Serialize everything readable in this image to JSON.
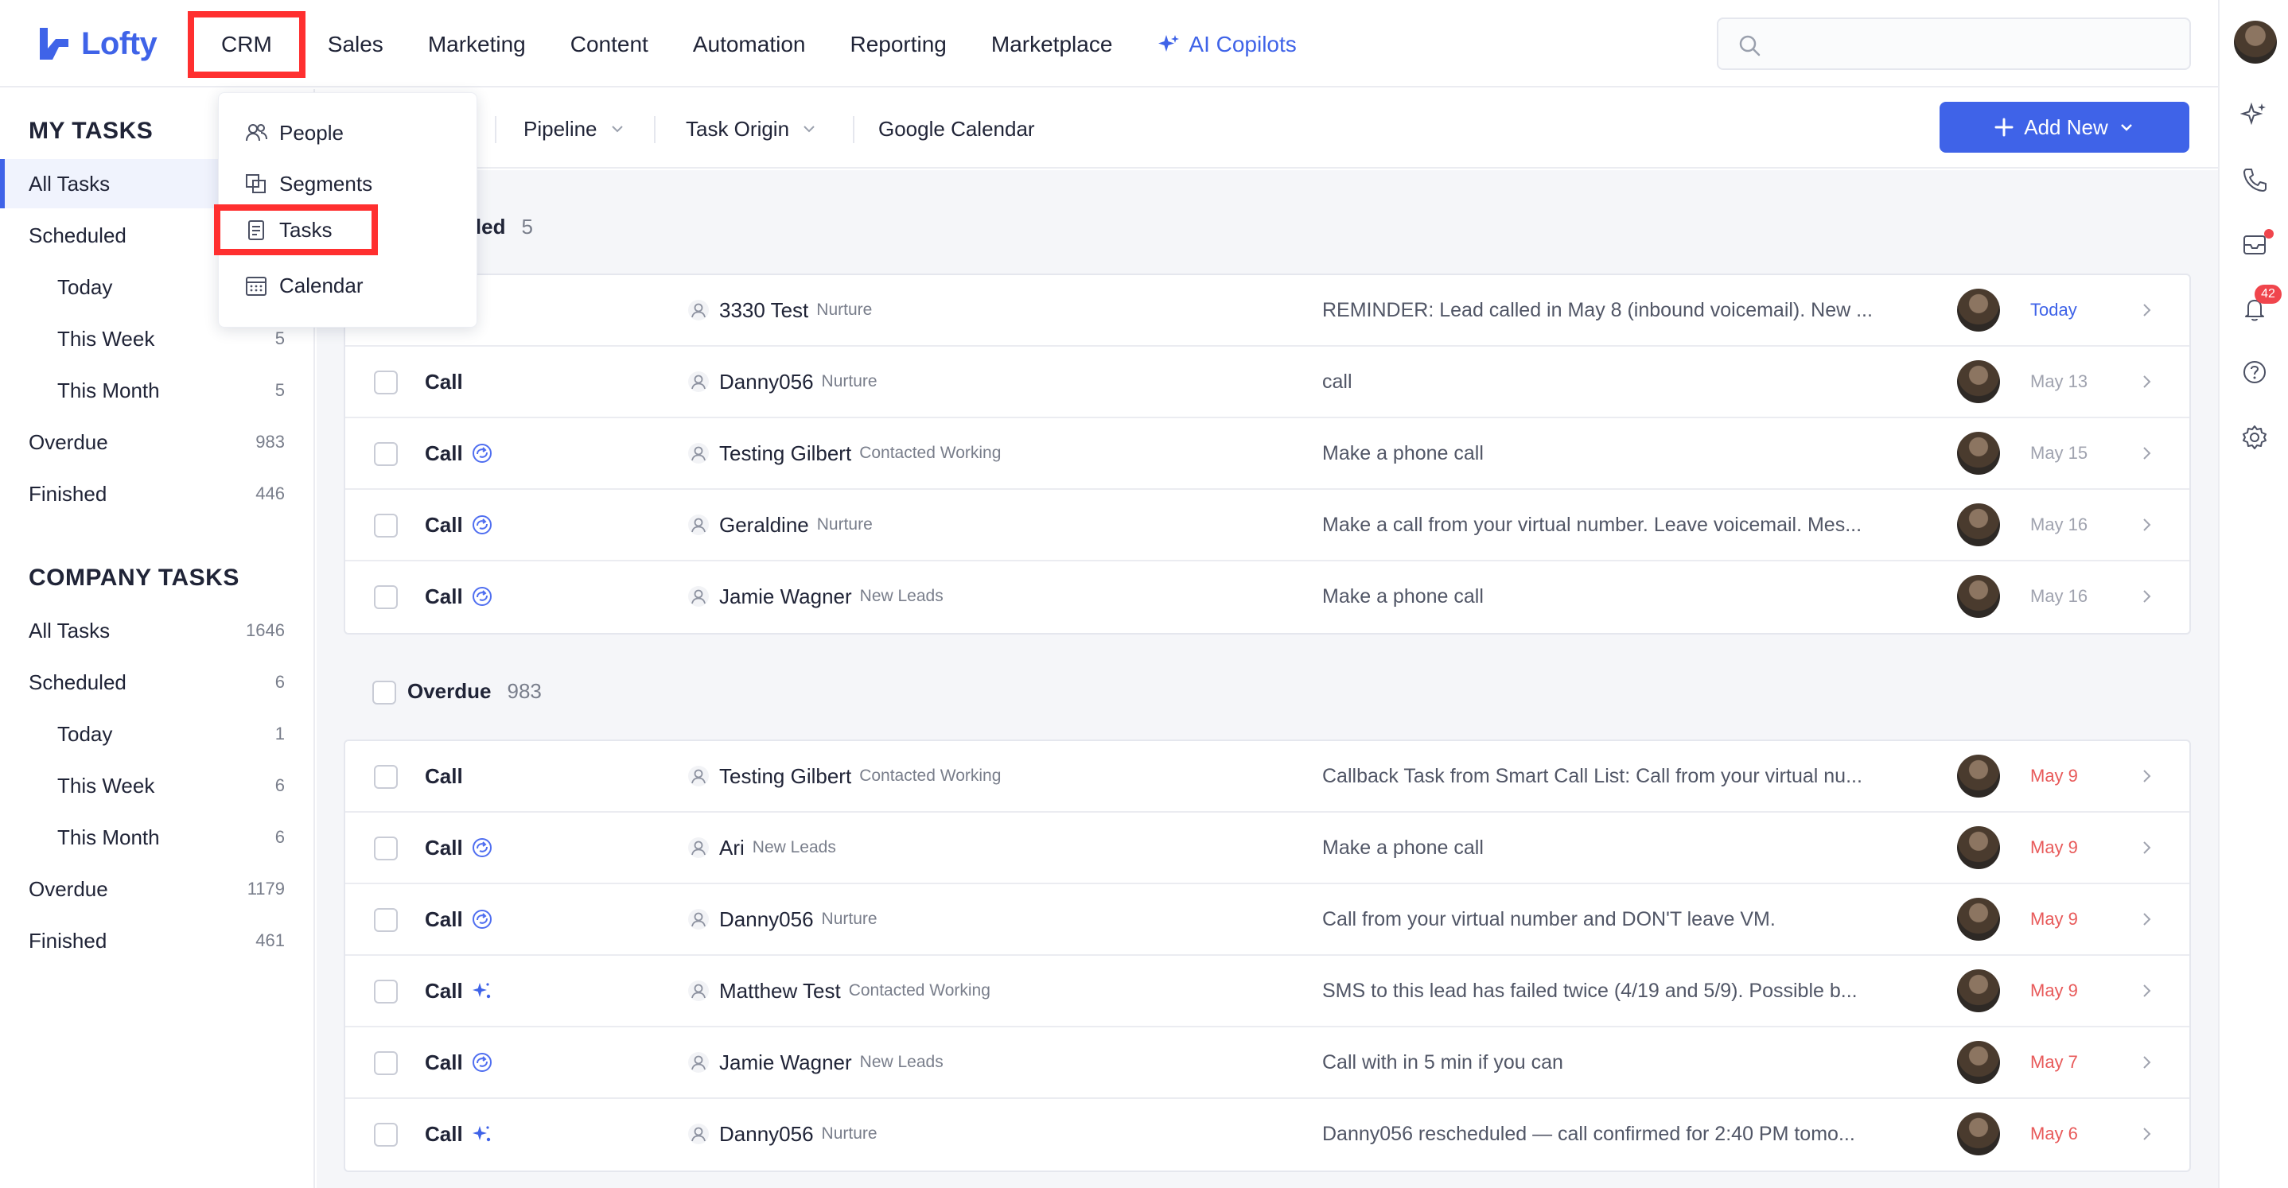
{
  "brand": {
    "name": "Lofty",
    "color": "#3f63e8"
  },
  "nav": {
    "items": [
      "CRM",
      "Sales",
      "Marketing",
      "Content",
      "Automation",
      "Reporting",
      "Marketplace"
    ],
    "ai_label": "AI Copilots"
  },
  "search": {
    "placeholder": ""
  },
  "rail": {
    "notification_count": "42"
  },
  "dropdown": {
    "items": [
      "People",
      "Segments",
      "Tasks",
      "Calendar"
    ]
  },
  "sidebar": {
    "my_tasks_title": "MY TASKS",
    "my_tasks": [
      {
        "label": "All Tasks",
        "count": ""
      },
      {
        "label": "Scheduled",
        "count": ""
      },
      {
        "label": "Today",
        "count": ""
      },
      {
        "label": "This Week",
        "count": "5"
      },
      {
        "label": "This Month",
        "count": "5"
      },
      {
        "label": "Overdue",
        "count": "983"
      },
      {
        "label": "Finished",
        "count": "446"
      }
    ],
    "company_tasks_title": "COMPANY TASKS",
    "company_tasks": [
      {
        "label": "All Tasks",
        "count": "1646"
      },
      {
        "label": "Scheduled",
        "count": "6"
      },
      {
        "label": "Today",
        "count": "1"
      },
      {
        "label": "This Week",
        "count": "6"
      },
      {
        "label": "This Month",
        "count": "6"
      },
      {
        "label": "Overdue",
        "count": "1179"
      },
      {
        "label": "Finished",
        "count": "461"
      }
    ]
  },
  "toolbar": {
    "filters": [
      "Pipeline",
      "Task Origin"
    ],
    "calendar_link": "Google Calendar",
    "add_new": "Add New"
  },
  "sections": {
    "scheduled": {
      "title": "uled",
      "count": "5"
    },
    "overdue": {
      "title": "Overdue",
      "count": "983"
    }
  },
  "scheduled_rows": [
    {
      "type": "",
      "icon": "sparkle-icon",
      "name": "3330 Test",
      "stage": "Nurture",
      "desc": "REMINDER: Lead called in May 8 (inbound voicemail). New ...",
      "date": "Today",
      "date_color": "blue"
    },
    {
      "type": "Call",
      "icon": "",
      "name": "Danny056",
      "stage": "Nurture",
      "desc": "call",
      "date": "May 13",
      "date_color": "gray"
    },
    {
      "type": "Call",
      "icon": "repeat-icon",
      "name": "Testing Gilbert",
      "stage": "Contacted Working",
      "desc": "Make a phone call",
      "date": "May 15",
      "date_color": "gray"
    },
    {
      "type": "Call",
      "icon": "repeat-icon",
      "name": "Geraldine",
      "stage": "Nurture",
      "desc": "Make a call from your virtual number. Leave voicemail. Mes...",
      "date": "May 16",
      "date_color": "gray"
    },
    {
      "type": "Call",
      "icon": "repeat-icon",
      "name": "Jamie Wagner",
      "stage": "New Leads",
      "desc": "Make a phone call",
      "date": "May 16",
      "date_color": "gray"
    }
  ],
  "overdue_rows": [
    {
      "type": "Call",
      "icon": "",
      "name": "Testing Gilbert",
      "stage": "Contacted Working",
      "desc": "Callback Task from Smart Call List: Call from your virtual nu...",
      "date": "May 9",
      "date_color": "red"
    },
    {
      "type": "Call",
      "icon": "repeat-icon",
      "name": "Ari",
      "stage": "New Leads",
      "desc": "Make a phone call",
      "date": "May 9",
      "date_color": "red"
    },
    {
      "type": "Call",
      "icon": "repeat-icon",
      "name": "Danny056",
      "stage": "Nurture",
      "desc": "Call from your virtual number and DON'T leave VM.",
      "date": "May 9",
      "date_color": "red"
    },
    {
      "type": "Call",
      "icon": "sparkle-icon",
      "name": "Matthew Test",
      "stage": "Contacted Working",
      "desc": "SMS to this lead has failed twice (4/19 and 5/9). Possible b...",
      "date": "May 9",
      "date_color": "red"
    },
    {
      "type": "Call",
      "icon": "repeat-icon",
      "name": "Jamie Wagner",
      "stage": "New Leads",
      "desc": "Call with in 5 min if you can",
      "date": "May 7",
      "date_color": "red"
    },
    {
      "type": "Call",
      "icon": "sparkle-icon",
      "name": "Danny056",
      "stage": "Nurture",
      "desc": "Danny056 rescheduled — call confirmed for 2:40 PM tomo...",
      "date": "May 6",
      "date_color": "red"
    }
  ]
}
